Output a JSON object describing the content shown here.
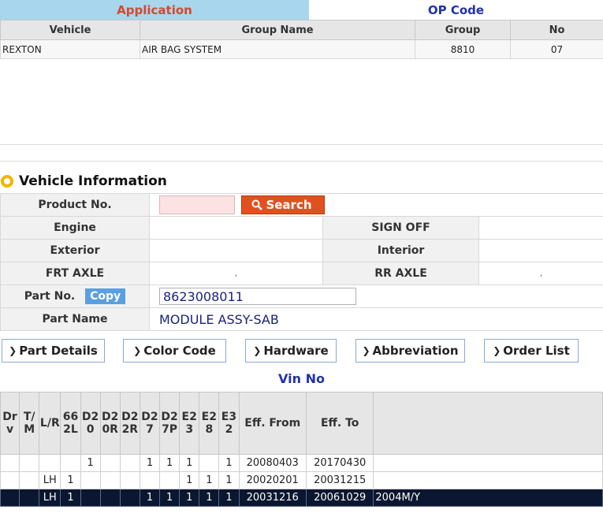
{
  "tabs": {
    "application": "Application",
    "op_code": "OP Code"
  },
  "groups": {
    "headers": [
      "Vehicle",
      "Group Name",
      "Group",
      "No"
    ],
    "rows": [
      {
        "vehicle": "REXTON",
        "group_name": "AIR BAG SYSTEM",
        "group": "8810",
        "no": "07"
      }
    ]
  },
  "vehicle_info": {
    "title": "Vehicle Information",
    "product_no_label": "Product No.",
    "product_no_value": "",
    "search_label": "Search",
    "engine_label": "Engine",
    "engine_value": "",
    "sign_off_label": "SIGN OFF",
    "sign_off_value": "",
    "exterior_label": "Exterior",
    "exterior_value": "",
    "interior_label": "Interior",
    "interior_value": "",
    "frt_axle_label": "FRT AXLE",
    "frt_axle_value": ",",
    "rr_axle_label": "RR AXLE",
    "rr_axle_value": ",",
    "part_no_label": "Part No.",
    "copy_label": "Copy",
    "part_no_value": "8623008011",
    "part_name_label": "Part Name",
    "part_name_value": "MODULE ASSY-SAB"
  },
  "actions": {
    "part_details": "Part Details",
    "color_code": "Color Code",
    "hardware": "Hardware",
    "abbreviation": "Abbreviation",
    "order_list": "Order List"
  },
  "vin": {
    "title": "Vin No",
    "headers": [
      "Drv",
      "T/M",
      "L/R",
      "662L",
      "D20",
      "D20R",
      "D22R",
      "D27",
      "D27P",
      "E23",
      "E28",
      "E32",
      "Eff. From",
      "Eff. To",
      ""
    ],
    "rows": [
      [
        "",
        "",
        "",
        "",
        "1",
        "",
        "",
        "1",
        "1",
        "1",
        "",
        "1",
        "20080403",
        "20170430",
        ""
      ],
      [
        "",
        "",
        "LH",
        "1",
        "",
        "",
        "",
        "",
        "",
        "1",
        "1",
        "1",
        "20020201",
        "20031215",
        ""
      ],
      [
        "",
        "",
        "LH",
        "1",
        "",
        "",
        "",
        "1",
        "1",
        "1",
        "1",
        "1",
        "20031216",
        "20061029",
        "2004M/Y"
      ]
    ],
    "selected_row": 2
  },
  "colors": {
    "tab_active_bg": "#a8d6ec",
    "accent_orange": "#e1511f",
    "copy_blue": "#5b9fe3",
    "selected_row_bg": "#0b1730",
    "title_blue": "#2233aa"
  }
}
